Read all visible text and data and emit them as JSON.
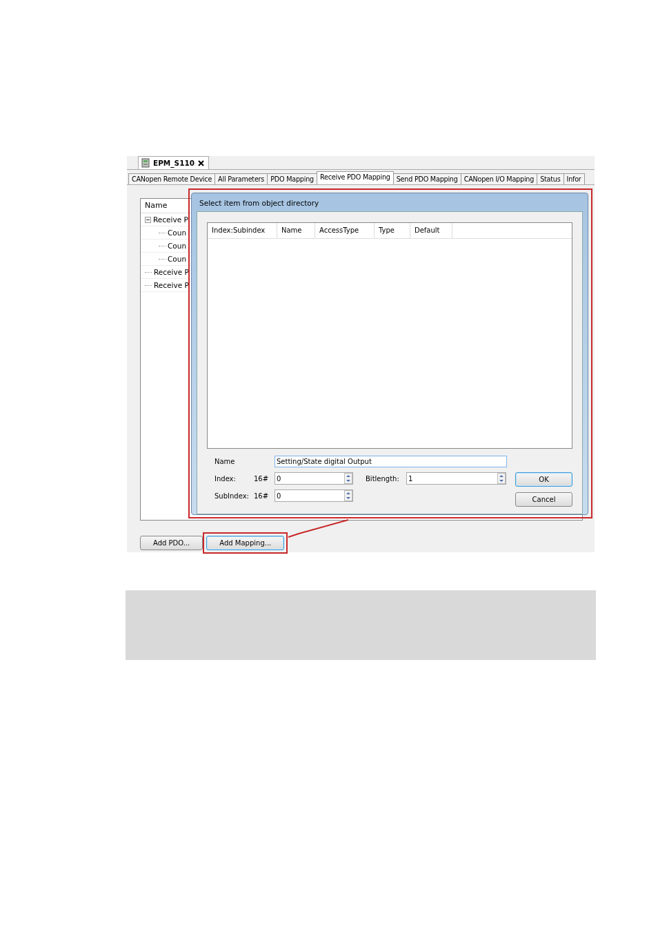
{
  "document_tab": {
    "title": "EPM_S110"
  },
  "tabs": [
    {
      "label": "CANopen Remote Device",
      "selected": false
    },
    {
      "label": "All Parameters",
      "selected": false
    },
    {
      "label": "PDO Mapping",
      "selected": false
    },
    {
      "label": "Receive PDO Mapping",
      "selected": true
    },
    {
      "label": "Send PDO Mapping",
      "selected": false
    },
    {
      "label": "CANopen I/O Mapping",
      "selected": false
    },
    {
      "label": "Status",
      "selected": false
    },
    {
      "label": "Infor",
      "selected": false
    }
  ],
  "tree": {
    "header": "Name",
    "items": [
      {
        "label": "Receive P",
        "expanded": true,
        "children": [
          {
            "label": "Coun"
          },
          {
            "label": "Coun"
          },
          {
            "label": "Coun"
          }
        ]
      },
      {
        "label": "Receive P"
      },
      {
        "label": "Receive P"
      }
    ]
  },
  "buttons": [
    {
      "label": "Add PDO...",
      "focused": false,
      "highlighted": false
    },
    {
      "label": "Add Mapping...",
      "focused": true,
      "highlighted": true
    }
  ],
  "dialog": {
    "title": "Select item from object directory",
    "highlighted": true,
    "columns": [
      "Index:Subindex",
      "Name",
      "AccessType",
      "Type",
      "Default"
    ],
    "name_label": "Name",
    "name_value": "Setting/State digital Output",
    "index_label": "Index:",
    "index_prefix": "16#",
    "index_value": "0",
    "bitlength_label": "Bitlength:",
    "bitlength_value": "1",
    "subindex_label": "SubIndex:",
    "subindex_prefix": "16#",
    "subindex_value": "0",
    "buttons": [
      {
        "label": "OK",
        "default": true
      },
      {
        "label": "Cancel",
        "default": false
      }
    ]
  }
}
